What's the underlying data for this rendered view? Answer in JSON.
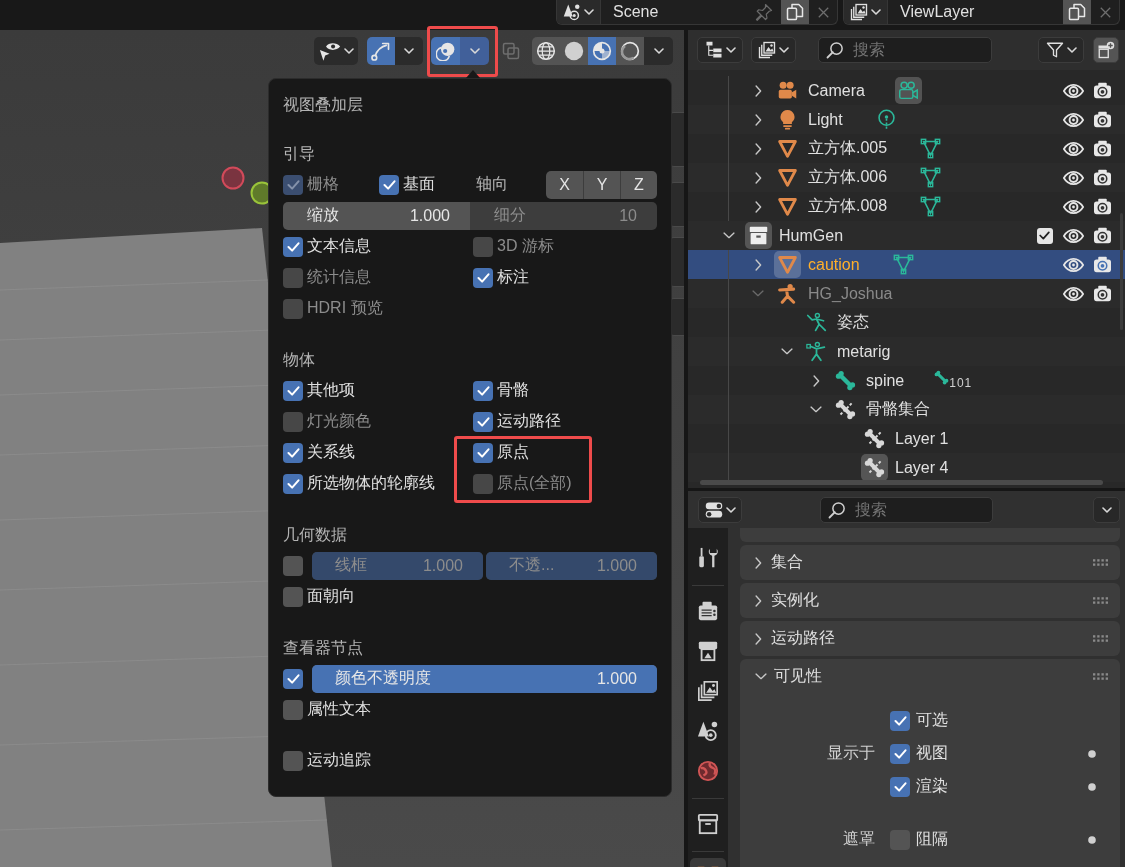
{
  "top_bar": {
    "scene": {
      "name": "Scene"
    },
    "view_layer": {
      "name": "ViewLayer"
    }
  },
  "viewport_header": {
    "gizmos": {
      "on": true,
      "menu_open": false
    },
    "overlays": {
      "on": true,
      "menu_open": true,
      "highlighted": true
    },
    "xray": {
      "on": false
    },
    "shading": {
      "modes": [
        {
          "kind": "wireframe",
          "selected": false
        },
        {
          "kind": "solid",
          "selected": false
        },
        {
          "kind": "material",
          "selected": true
        },
        {
          "kind": "rendered",
          "selected": false
        }
      ],
      "menu_open": false
    }
  },
  "overlays_popover": {
    "title": "视图叠加层",
    "sections": [
      {
        "title": "引导",
        "rows": [
          {
            "kind": "floor",
            "checks": [
              {
                "label": "栅格",
                "checked": true,
                "disabled": true
              },
              {
                "label": "基面",
                "checked": true,
                "disabled": false
              }
            ],
            "axes_label": "轴向",
            "axes": [
              {
                "label": "X",
                "on": false
              },
              {
                "label": "Y",
                "on": false
              },
              {
                "label": "Z",
                "on": false
              }
            ]
          },
          {
            "kind": "fields",
            "fields": [
              {
                "label": "缩放",
                "value": "1.000",
                "disabled": false
              },
              {
                "label": "细分",
                "value": "10",
                "disabled": true
              }
            ]
          },
          {
            "kind": "checks",
            "items": [
              {
                "label": "文本信息",
                "checked": true,
                "disabled": false
              },
              {
                "label": "3D 游标",
                "checked": false,
                "disabled": true
              },
              {
                "label": "统计信息",
                "checked": false,
                "disabled": true
              },
              {
                "label": "标注",
                "checked": true,
                "disabled": false
              },
              {
                "label": "HDRI 预览",
                "checked": false,
                "disabled": true
              }
            ]
          }
        ]
      },
      {
        "title": "物体",
        "rows": [
          {
            "kind": "checks",
            "items": [
              {
                "label": "其他项",
                "checked": true,
                "disabled": false,
                "highlighted": false
              },
              {
                "label": "骨骼",
                "checked": true,
                "disabled": false,
                "highlighted": false
              },
              {
                "label": "灯光颜色",
                "checked": false,
                "disabled": true,
                "highlighted": false
              },
              {
                "label": "运动路径",
                "checked": true,
                "disabled": false,
                "highlighted": false
              },
              {
                "label": "关系线",
                "checked": true,
                "disabled": false,
                "highlighted": false
              },
              {
                "label": "原点",
                "checked": true,
                "disabled": false,
                "highlighted": true
              },
              {
                "label": "所选物体的轮廓线",
                "checked": true,
                "disabled": false,
                "highlighted": false
              },
              {
                "label": "原点(全部)",
                "checked": false,
                "disabled": true,
                "highlighted": true
              }
            ]
          }
        ]
      },
      {
        "title": "几何数据",
        "rows": [
          {
            "kind": "check_sliders",
            "checked": false,
            "sliders": [
              {
                "label": "线框",
                "value": "1.000",
                "level": 1,
                "disabled": true
              },
              {
                "label": "不透...",
                "value": "1.000",
                "level": 1,
                "disabled": true
              }
            ]
          },
          {
            "kind": "checks",
            "items": [
              {
                "label": "面朝向",
                "checked": false,
                "disabled": false
              }
            ]
          }
        ]
      },
      {
        "title": "查看器节点",
        "rows": [
          {
            "kind": "check_sliders",
            "checked": true,
            "sliders": [
              {
                "label": "颜色不透明度",
                "value": "1.000",
                "level": 1,
                "disabled": false
              }
            ]
          },
          {
            "kind": "checks",
            "items": [
              {
                "label": "属性文本",
                "checked": false,
                "disabled": false
              }
            ]
          }
        ]
      },
      {
        "rows": [
          {
            "kind": "checks",
            "items": [
              {
                "label": "运动追踪",
                "checked": false,
                "disabled": false
              }
            ]
          }
        ]
      }
    ]
  },
  "outliner": {
    "search": {
      "placeholder": "搜索"
    },
    "tree": [
      {
        "children": [
          {
            "label": "Camera",
            "kind": "camera",
            "expanded": false,
            "selected": false,
            "active": false,
            "dimmed": false,
            "data": {
              "kind": "camera",
              "active": true
            },
            "visible": true,
            "renderable": true
          },
          {
            "label": "Light",
            "kind": "light",
            "expanded": false,
            "selected": false,
            "active": false,
            "dimmed": false,
            "data": {
              "kind": "light",
              "active": false
            },
            "visible": true,
            "renderable": true
          },
          {
            "label": "立方体.005",
            "kind": "mesh",
            "expanded": false,
            "selected": false,
            "active": false,
            "dimmed": false,
            "data": {
              "kind": "mesh",
              "active": false
            },
            "visible": true,
            "renderable": true
          },
          {
            "label": "立方体.006",
            "kind": "mesh",
            "expanded": false,
            "selected": false,
            "active": false,
            "dimmed": false,
            "data": {
              "kind": "mesh",
              "active": false
            },
            "visible": true,
            "renderable": true
          },
          {
            "label": "立方体.008",
            "kind": "mesh",
            "expanded": false,
            "selected": false,
            "active": false,
            "dimmed": false,
            "data": {
              "kind": "mesh",
              "active": false
            },
            "visible": true,
            "renderable": true
          }
        ]
      },
      {
        "label": "HumGen",
        "kind": "collection",
        "expanded": true,
        "selected": false,
        "active": true,
        "dimmed": false,
        "checked": true,
        "visible": true,
        "renderable": true,
        "children": [
          {
            "label": "caution",
            "kind": "mesh",
            "expanded": false,
            "selected": true,
            "active": true,
            "dimmed": false,
            "data": {
              "kind": "mesh",
              "active": false
            },
            "visible": true,
            "renderable": true
          },
          {
            "label": "HG_Joshua",
            "kind": "armature",
            "expanded": true,
            "selected": false,
            "active": false,
            "dimmed": true,
            "visible": true,
            "renderable": true,
            "children": [
              {
                "label": "姿态",
                "kind": "pose",
                "selected": false,
                "active": false,
                "dimmed": false
              },
              {
                "label": "metarig",
                "kind": "armature_data",
                "expanded": true,
                "selected": false,
                "active": false,
                "dimmed": false,
                "children": [
                  {
                    "label": "spine",
                    "kind": "bone",
                    "expanded": false,
                    "selected": false,
                    "active": false,
                    "dimmed": false,
                    "data": {
                      "kind": "bone",
                      "active": false,
                      "count": "101"
                    }
                  },
                  {
                    "label": "骨骼集合",
                    "kind": "bone_collections",
                    "expanded": true,
                    "selected": false,
                    "active": false,
                    "dimmed": false,
                    "children": [
                      {
                        "label": "Layer 1",
                        "kind": "bone_collection",
                        "selected": false,
                        "active": false,
                        "dimmed": false
                      },
                      {
                        "label": "Layer 4",
                        "kind": "bone_collection",
                        "selected": false,
                        "active": true,
                        "dimmed": false
                      }
                    ]
                  }
                ]
              }
            ]
          }
        ]
      }
    ]
  },
  "properties": {
    "search": {
      "placeholder": "搜索"
    },
    "tabs": [
      {
        "kind": "tool",
        "selected": false
      },
      {
        "kind": "render",
        "selected": false
      },
      {
        "kind": "output",
        "selected": false
      },
      {
        "kind": "view_layer",
        "selected": false
      },
      {
        "kind": "scene",
        "selected": false
      },
      {
        "kind": "world",
        "selected": false
      },
      {
        "kind": "collection",
        "selected": false
      },
      {
        "kind": "object",
        "selected": true
      }
    ],
    "panels": [
      {
        "title": "集合",
        "expanded": false
      },
      {
        "title": "实例化",
        "expanded": false
      },
      {
        "title": "运动路径",
        "expanded": false
      },
      {
        "title": "可见性",
        "expanded": true,
        "groups": [
          [
            {
              "check": "可选",
              "checked": true,
              "animatable": false
            },
            {
              "label": "显示于",
              "check": "视图",
              "checked": true,
              "animatable": true
            },
            {
              "check": "渲染",
              "checked": true,
              "animatable": true
            }
          ],
          [
            {
              "label": "遮罩",
              "check": "阻隔",
              "checked": false,
              "animatable": true
            }
          ]
        ]
      }
    ]
  }
}
